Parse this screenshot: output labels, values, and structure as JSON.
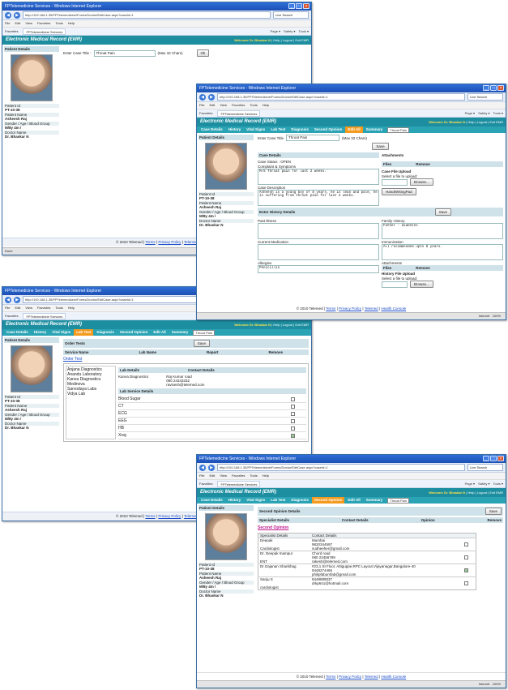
{
  "browser": {
    "title": "FPTelemedicine Services - Windows Internet Explorer",
    "url": "http://192.168.1.35/FPTelemedicine/Forms/Doctor/EditCase.aspx?caseId=1",
    "search_placeholder": "Live Search",
    "menu": [
      "File",
      "Edit",
      "View",
      "Favorites",
      "Tools",
      "Help"
    ],
    "favorites_label": "Favorites",
    "tab_label": "FPTelemedicine Services",
    "toolbar": [
      "Page ▾",
      "Safety ▾",
      "Tools ▾"
    ],
    "status_done": "Done",
    "status_zone": "Internet",
    "zoom": "100%"
  },
  "app": {
    "title": "Electronic Medical Record (EMR)",
    "welcome": "Welcome Dr. Bhaskar N",
    "welcome_name": "Dr. Bhaskar N",
    "links": [
      "Help",
      "Logout",
      "Exit EMR"
    ],
    "tabs": [
      "Case Details",
      "History",
      "Vital Signs",
      "Lab Test",
      "Diagnosis",
      "Second Opinion",
      "Edit All",
      "Summary"
    ],
    "case_select": "Throat Pain",
    "footer_copy": "© 2010 Telemed",
    "footer_links": [
      "Terms",
      "Privacy Policy",
      "Telemed",
      "Health Console"
    ]
  },
  "patient": {
    "heading": "Patient Details",
    "id_label": "Patient Id",
    "id": "PT-10-38",
    "name_label": "Patient Name",
    "name": "Asheesh Raj",
    "gad_label": "Gender / Age / Blood Group",
    "gad": "M/8y 4m /",
    "doctor_label": "Doctor Name",
    "doctor": "Dr. Bhaskar N"
  },
  "win1": {
    "case_title_label": "Enter Case Title :",
    "case_title_value": "Throat Pain",
    "max_chars": "(Max 32 Chars)",
    "ok": "Ok"
  },
  "win2": {
    "case_title_label": "Enter Case Title",
    "case_title_value": "Throat Pain",
    "max_chars": "(Max 32 Chars)",
    "save": "Save",
    "case_details_heading": "Case Details",
    "attachments_heading": "Attachments",
    "case_status": "Case Status : OPEN",
    "complaint_label": "Complaint & Symptoms",
    "complaint_text": "M/S Throat pain for last 2 weeks.",
    "case_desc_label": "Case Description",
    "case_desc_text": "Asheesh is a young boy of 8 years, he is lean and pale, he is suffering from throat pain for last 2 weeks.",
    "files_col": "Files",
    "remove_col": "Remove",
    "upload_title": "Case File Upload",
    "upload_hint": "Select a file to upload:",
    "browse": "Browse...",
    "handwriting": "HandWritingPad",
    "history_heading": "Enter History Details",
    "save2": "Save",
    "past_illness": "Past Illness",
    "family_history": "Family History",
    "family_text": "Father - diabetes",
    "current_med": "Current Medication",
    "immunization": "Immunization",
    "immunization_text": "All recommended upto 8 years.",
    "allergies": "Allergies",
    "allergies_text": "Penicillin",
    "attachments2": "Attachments",
    "files2": "Files",
    "remove2": "Remove",
    "hist_upload": "History File Upload",
    "hist_hint": "Select a file to upload:",
    "browse2": "Browse..."
  },
  "win3": {
    "order_tests": "Order Tests",
    "save": "Save",
    "cols": [
      "Service Name",
      "Lab Name",
      "Report",
      "Remove"
    ],
    "order_link": "Order Test",
    "labs": [
      "Anjana Diagnostics",
      "Anandu Laboratory",
      "Kanva Diagnostics",
      "Medinova",
      "Sarvodaya Labs",
      "Vidya Lab"
    ],
    "lab_details": "Lab Details",
    "contact_details": "Contact Details",
    "lab_name": "Kanva Diagnostics",
    "contact_lines": [
      "Raj Kumar road",
      "080 24343332",
      "ravisesh@telemed.com"
    ],
    "services_heading": "Lab Service Details",
    "services": [
      {
        "name": "Blood Sugar",
        "checked": false
      },
      {
        "name": "CT",
        "checked": false
      },
      {
        "name": "ECG",
        "checked": false
      },
      {
        "name": "EEG",
        "checked": false
      },
      {
        "name": "HB",
        "checked": false
      },
      {
        "name": "Xray",
        "checked": true
      }
    ]
  },
  "win4": {
    "heading": "Second Opinion Details",
    "save": "Save",
    "cols": [
      "Specialist Details",
      "Contact Details",
      "Opinion",
      "Remove"
    ],
    "link": "Second Opinion",
    "sub_cols": [
      "Specialist Details",
      "Contact Details"
    ],
    "rows": [
      {
        "name": "Deepak",
        "spec": "Cardiologist",
        "contact": [
          "Mumbai",
          "9820344597",
          "sudheeher@gmail.com"
        ],
        "checked": false
      },
      {
        "name": "Dr. Deepak  Inampur",
        "spec": "ENT",
        "contact": [
          "Chord road",
          "080 23456789",
          "rakesh@telemed.com"
        ],
        "checked": false
      },
      {
        "name": "Dr.Gajanan Shanbhag",
        "spec": "",
        "contact": [
          "#23,1 St Floor, Attiguppe,RPC Layout,Vijayanagar,Bangalore-40",
          "9448274466",
          "philipfabumfab@gmail.com"
        ],
        "checked": true
      },
      {
        "name": "Sanju.S",
        "spec": "cardiologist",
        "contact": [
          "9448889037",
          "drkp641@hotmail.com"
        ],
        "checked": false
      }
    ]
  }
}
